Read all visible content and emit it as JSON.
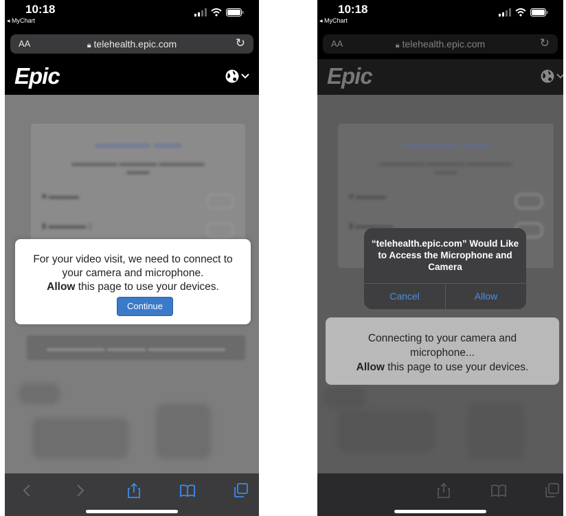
{
  "left": {
    "status": {
      "time": "10:18",
      "back_app": "◂ MyChart"
    },
    "url_bar": {
      "text_size": "AA",
      "url": "telehealth.epic.com"
    },
    "header": {
      "logo": "Epic"
    },
    "dialog": {
      "line1": "For your video visit, we need to connect to",
      "line2": "your camera and microphone.",
      "line3_bold": "Allow",
      "line3_rest": " this page to use your devices.",
      "button": "Continue"
    }
  },
  "right": {
    "status": {
      "time": "10:18",
      "back_app": "◂ MyChart"
    },
    "url_bar": {
      "text_size": "AA",
      "url": "telehealth.epic.com"
    },
    "header": {
      "logo": "Epic"
    },
    "alert": {
      "title": "“telehealth.epic.com” Would Like to Access the Microphone and Camera",
      "cancel": "Cancel",
      "allow": "Allow"
    },
    "connecting": {
      "line1": "Connecting to your camera and",
      "line2": "microphone...",
      "line3_bold": "Allow",
      "line3_rest": " this page to use your devices."
    }
  },
  "colors": {
    "accent": "#3b79c9",
    "ios_blue": "#4a90e2",
    "toolbar": "#3b3b3d"
  }
}
